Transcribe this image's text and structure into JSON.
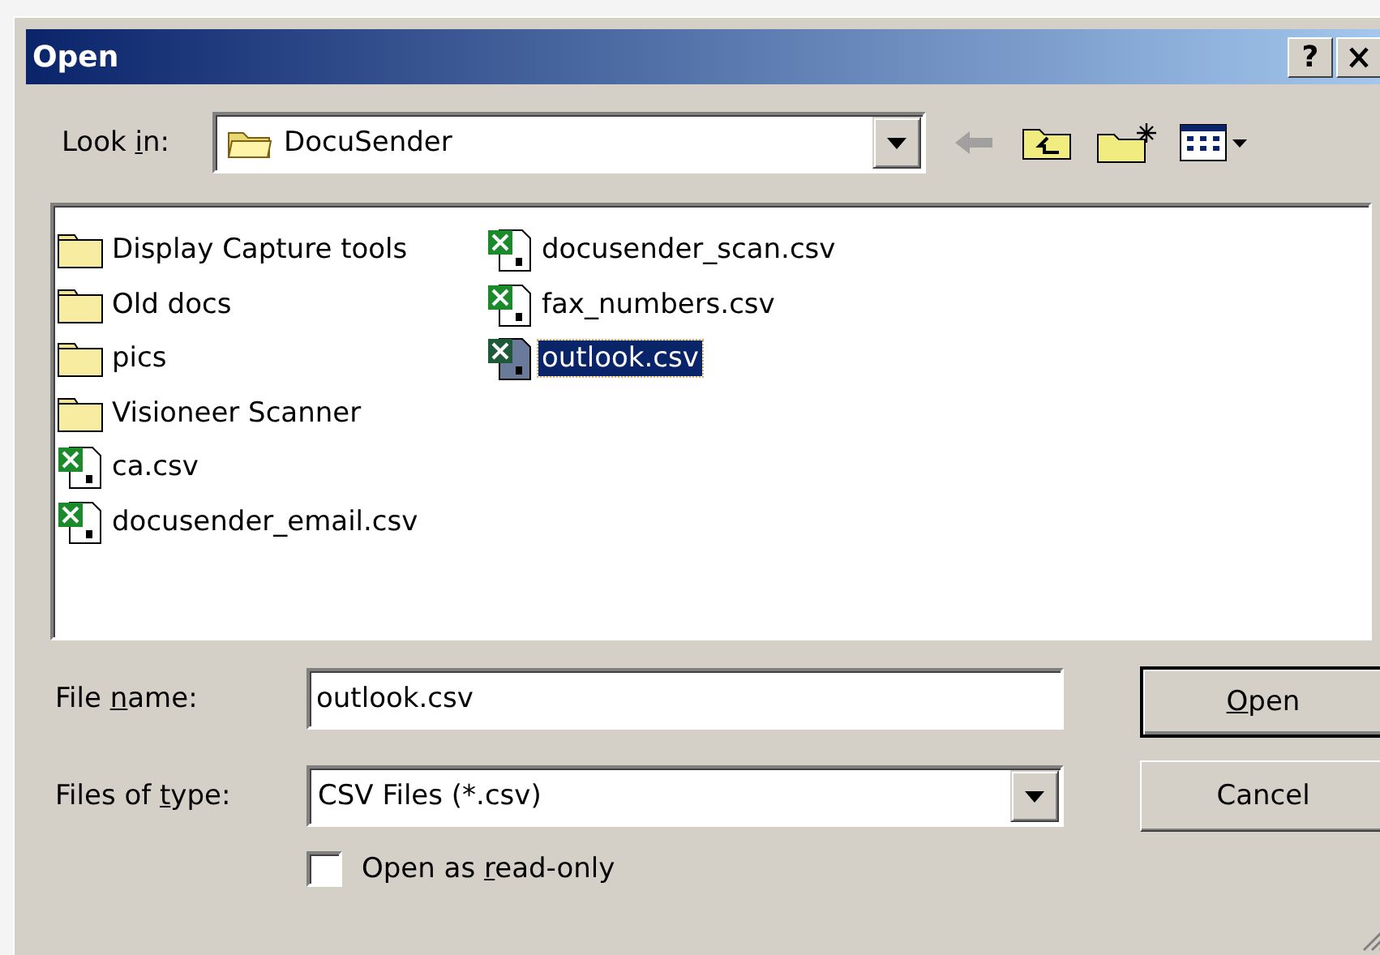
{
  "window": {
    "title": "Open",
    "help_button": "?"
  },
  "look_in": {
    "label": [
      "Look ",
      "i",
      "n:"
    ],
    "value": "DocuSender"
  },
  "files": [
    {
      "name": "Display Capture tools",
      "kind": "folder",
      "selected": false
    },
    {
      "name": "Old docs",
      "kind": "folder",
      "selected": false
    },
    {
      "name": "pics",
      "kind": "folder",
      "selected": false
    },
    {
      "name": "Visioneer Scanner",
      "kind": "folder",
      "selected": false
    },
    {
      "name": "ca.csv",
      "kind": "csv",
      "selected": false
    },
    {
      "name": "docusender_email.csv",
      "kind": "csv",
      "selected": false
    },
    {
      "name": "docusender_scan.csv",
      "kind": "csv",
      "selected": false
    },
    {
      "name": "fax_numbers.csv",
      "kind": "csv",
      "selected": false
    },
    {
      "name": "outlook.csv",
      "kind": "csv",
      "selected": true
    }
  ],
  "file_name": {
    "label": [
      "File ",
      "n",
      "ame:"
    ],
    "value": "outlook.csv"
  },
  "file_type": {
    "label": [
      "Files of ",
      "t",
      "ype:"
    ],
    "value": "CSV Files (*.csv)"
  },
  "buttons": [
    {
      "label": [
        {
          "text": "O",
          "underline": true
        },
        {
          "text": "pen",
          "underline": false
        }
      ],
      "default": true
    },
    {
      "label": [
        {
          "text": "Cancel",
          "underline": false
        }
      ],
      "default": false
    }
  ],
  "read_only": {
    "label": [
      "Open as ",
      "r",
      "ead-only"
    ],
    "checked": false
  }
}
